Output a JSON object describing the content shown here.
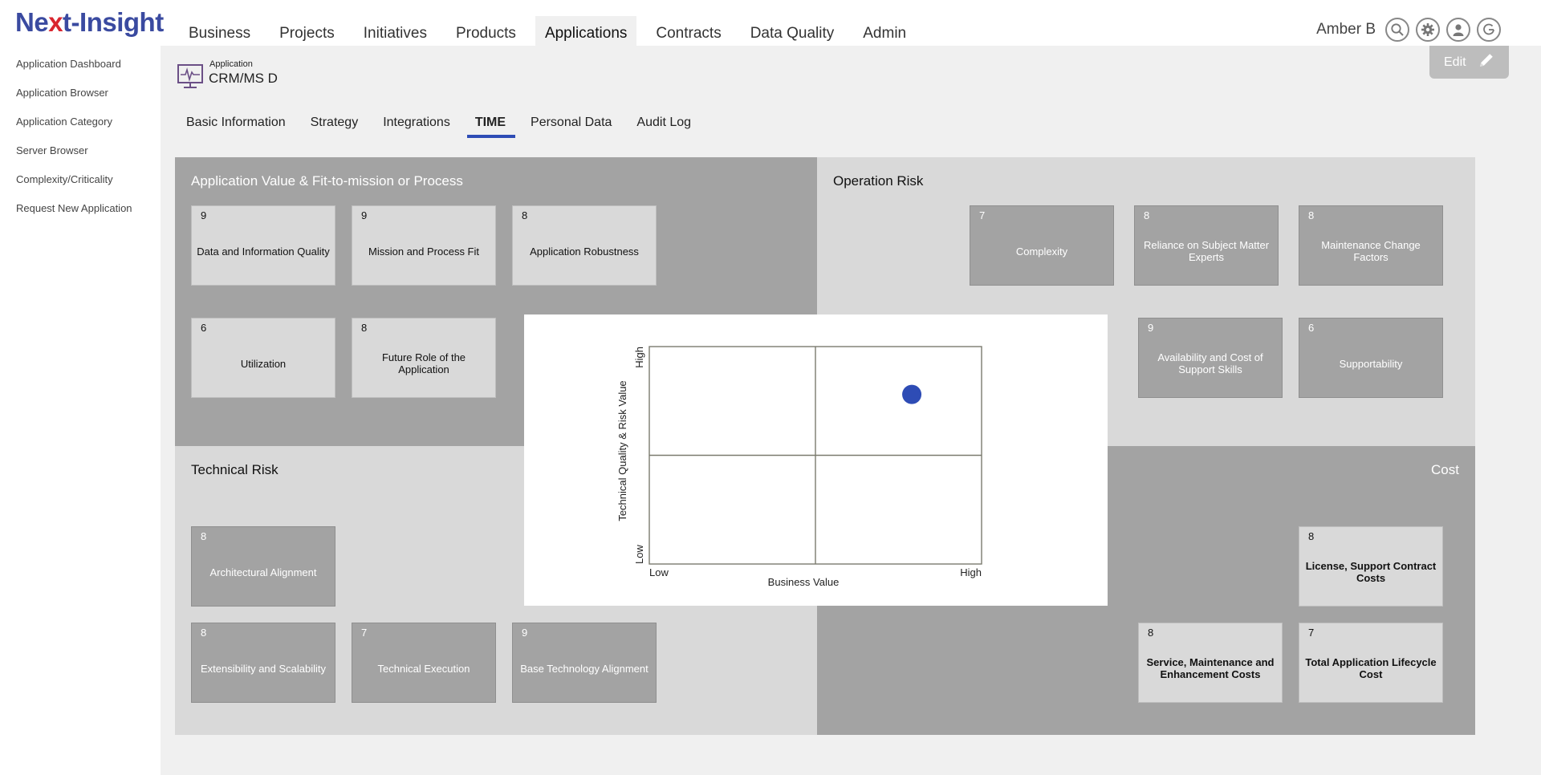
{
  "header": {
    "logo_pre": "Ne",
    "logo_x": "x",
    "logo_post": "t-Insight",
    "nav": [
      "Business",
      "Projects",
      "Initiatives",
      "Products",
      "Applications",
      "Contracts",
      "Data Quality",
      "Admin"
    ],
    "active_nav": "Applications",
    "user_name": "Amber B"
  },
  "sidebar": {
    "items": [
      "Application Dashboard",
      "Application Browser",
      "Application Category",
      "Server Browser",
      "Complexity/Criticality",
      "Request New Application"
    ]
  },
  "app": {
    "type_label": "Application",
    "name": "CRM/MS D",
    "edit_label": "Edit"
  },
  "tabs": {
    "items": [
      "Basic Information",
      "Strategy",
      "Integrations",
      "TIME",
      "Personal Data",
      "Audit Log"
    ],
    "active": "TIME"
  },
  "panels": {
    "value": {
      "title": "Application Value & Fit-to-mission or Process",
      "tiles": [
        {
          "score": "9",
          "label": "Data and Information Quality"
        },
        {
          "score": "9",
          "label": "Mission and Process Fit"
        },
        {
          "score": "8",
          "label": "Application Robustness"
        },
        {
          "score": "6",
          "label": "Utilization"
        },
        {
          "score": "8",
          "label": "Future Role of the Application"
        }
      ]
    },
    "operation_risk": {
      "title": "Operation Risk",
      "tiles": [
        {
          "score": "7",
          "label": "Complexity"
        },
        {
          "score": "8",
          "label": "Reliance on Subject Matter Experts"
        },
        {
          "score": "8",
          "label": "Maintenance Change Factors"
        },
        {
          "score": "9",
          "label": "Availability and Cost of Support Skills"
        },
        {
          "score": "6",
          "label": "Supportability"
        }
      ]
    },
    "technical_risk": {
      "title": "Technical Risk",
      "tiles": [
        {
          "score": "8",
          "label": "Architectural Alignment"
        },
        {
          "score": "8",
          "label": "Extensibility and Scalability"
        },
        {
          "score": "7",
          "label": "Technical Execution"
        },
        {
          "score": "9",
          "label": "Base Technology Alignment"
        }
      ]
    },
    "cost": {
      "title": "Cost",
      "tiles": [
        {
          "score": "8",
          "label": "License, Support Contract Costs"
        },
        {
          "score": "8",
          "label": "Service, Maintenance and Enhancement Costs"
        },
        {
          "score": "7",
          "label": "Total Application Lifecycle Cost"
        }
      ]
    }
  },
  "chart_data": {
    "type": "scatter",
    "xlabel": "Business Value",
    "ylabel": "Technical Quality & Risk Value",
    "x_tick_low": "Low",
    "x_tick_high": "High",
    "y_tick_low": "Low",
    "y_tick_high": "High",
    "xlim": [
      0,
      1
    ],
    "ylim": [
      0,
      1
    ],
    "points": [
      {
        "x": 0.79,
        "y": 0.78
      }
    ],
    "point_color": "#2e4cb5",
    "grid": "2x2 quadrants"
  },
  "colors": {
    "brand": "#3a4aa0",
    "logo_accent": "#d9262f",
    "tab_underline": "#2e4cb5",
    "dark_tile": "#a3a3a3",
    "light_tile": "#d9d9d9"
  }
}
